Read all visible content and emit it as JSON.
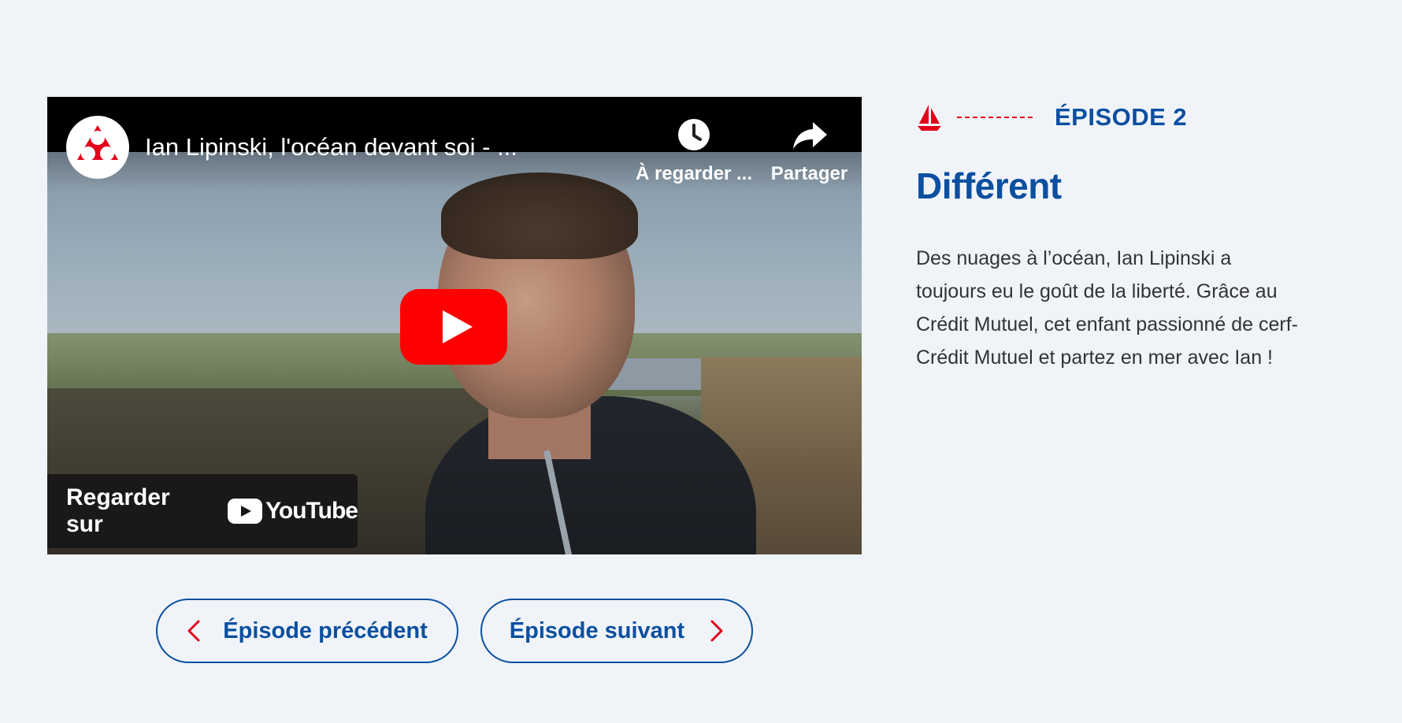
{
  "video": {
    "title": "Ian Lipinski, l'océan devant soi - ...",
    "watch_later_label": "À regarder ...",
    "share_label": "Partager",
    "watch_on_label": "Regarder sur",
    "youtube_wordmark": "YouTube"
  },
  "episode": {
    "label": "ÉPISODE 2",
    "title": "Différent",
    "description_lines": [
      "Des nuages à l’océan, Ian Lipinski a",
      "toujours eu le goût de la liberté. Grâce au",
      "Crédit Mutuel, cet enfant passionné de cerf-",
      "Crédit Mutuel et partez en mer avec Ian !"
    ]
  },
  "navigation": {
    "prev_label": "Épisode précédent",
    "next_label": "Épisode suivant"
  },
  "icons": {
    "boat": "sailboat-icon",
    "watch_later": "clock-icon",
    "share": "share-arrow-icon",
    "play": "play-icon",
    "prev": "chevron-left-icon",
    "next": "chevron-right-icon"
  },
  "colors": {
    "background": "#f0f4f8",
    "brand_blue": "#0b4fa0",
    "brand_red": "#e2001a",
    "youtube_red": "#ff0000",
    "text": "#333333"
  }
}
